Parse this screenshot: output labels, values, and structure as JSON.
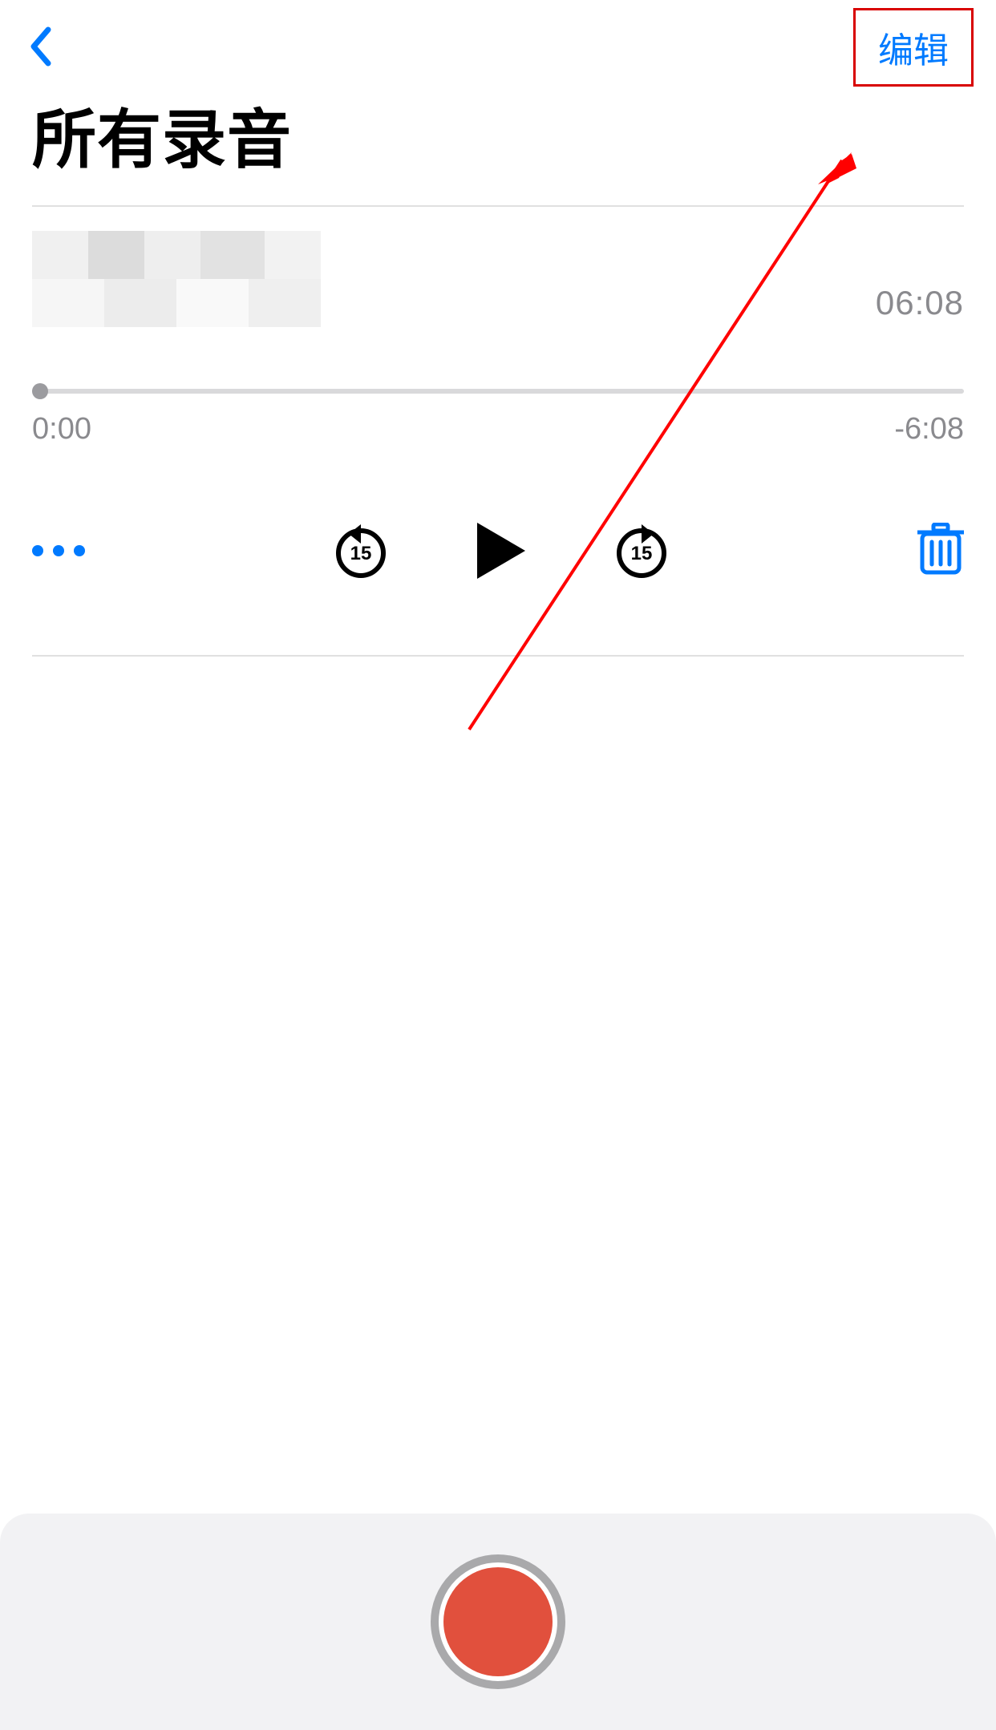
{
  "nav": {
    "edit_label": "编辑"
  },
  "title": "所有录音",
  "recording": {
    "duration": "06:08",
    "elapsed": "0:00",
    "remaining": "-6:08",
    "skip_seconds": "15"
  },
  "colors": {
    "accent": "#007aff",
    "record_red": "#e1503d",
    "annotation_red": "#d80000"
  }
}
